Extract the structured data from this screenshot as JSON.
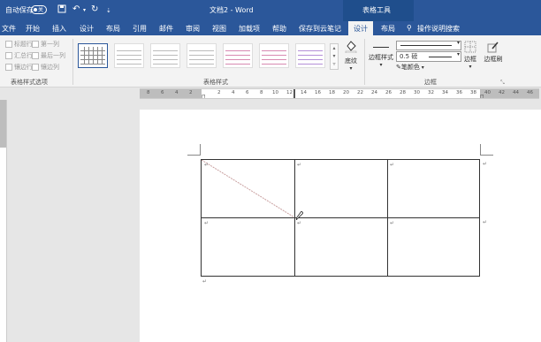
{
  "titlebar": {
    "autosave_label": "自动保存",
    "autosave_state": "关",
    "doc_title": "文档2 - Word",
    "context_label": "表格工具",
    "save_icon": "save-icon",
    "undo_icon": "undo-icon",
    "redo_icon": "redo-icon"
  },
  "tabs": [
    "文件",
    "开始",
    "插入",
    "设计",
    "布局",
    "引用",
    "邮件",
    "审阅",
    "视图",
    "加载项",
    "帮助",
    "保存到云笔记",
    "设计",
    "布局"
  ],
  "tell_me": "操作说明搜索",
  "ribbon": {
    "style_options": {
      "items": [
        "标题行",
        "第一列",
        "汇总行",
        "最后一列",
        "镶边行",
        "镶边列"
      ],
      "label": "表格样式选项"
    },
    "table_styles_label": "表格样式",
    "shading_label": "底纹",
    "border_styles_label": "边框样式",
    "line_weight": "0.5 磅",
    "pen_color_label": "笔颜色",
    "borders_label": "边框",
    "border_painter_label": "边框刷",
    "borders_group_label": "边框"
  },
  "ruler_numbers": [
    "8",
    "6",
    "4",
    "2",
    "2",
    "4",
    "6",
    "8",
    "10",
    "12",
    "14",
    "16",
    "18",
    "20",
    "22",
    "24",
    "26",
    "28",
    "30",
    "32",
    "34",
    "36",
    "38",
    "40",
    "42",
    "44",
    "46"
  ],
  "colors": {
    "accent": "#2b579a",
    "ribbon_bg": "#f3f3f3",
    "page_bg": "#ffffff",
    "diagonal": "#c9a0a0"
  }
}
